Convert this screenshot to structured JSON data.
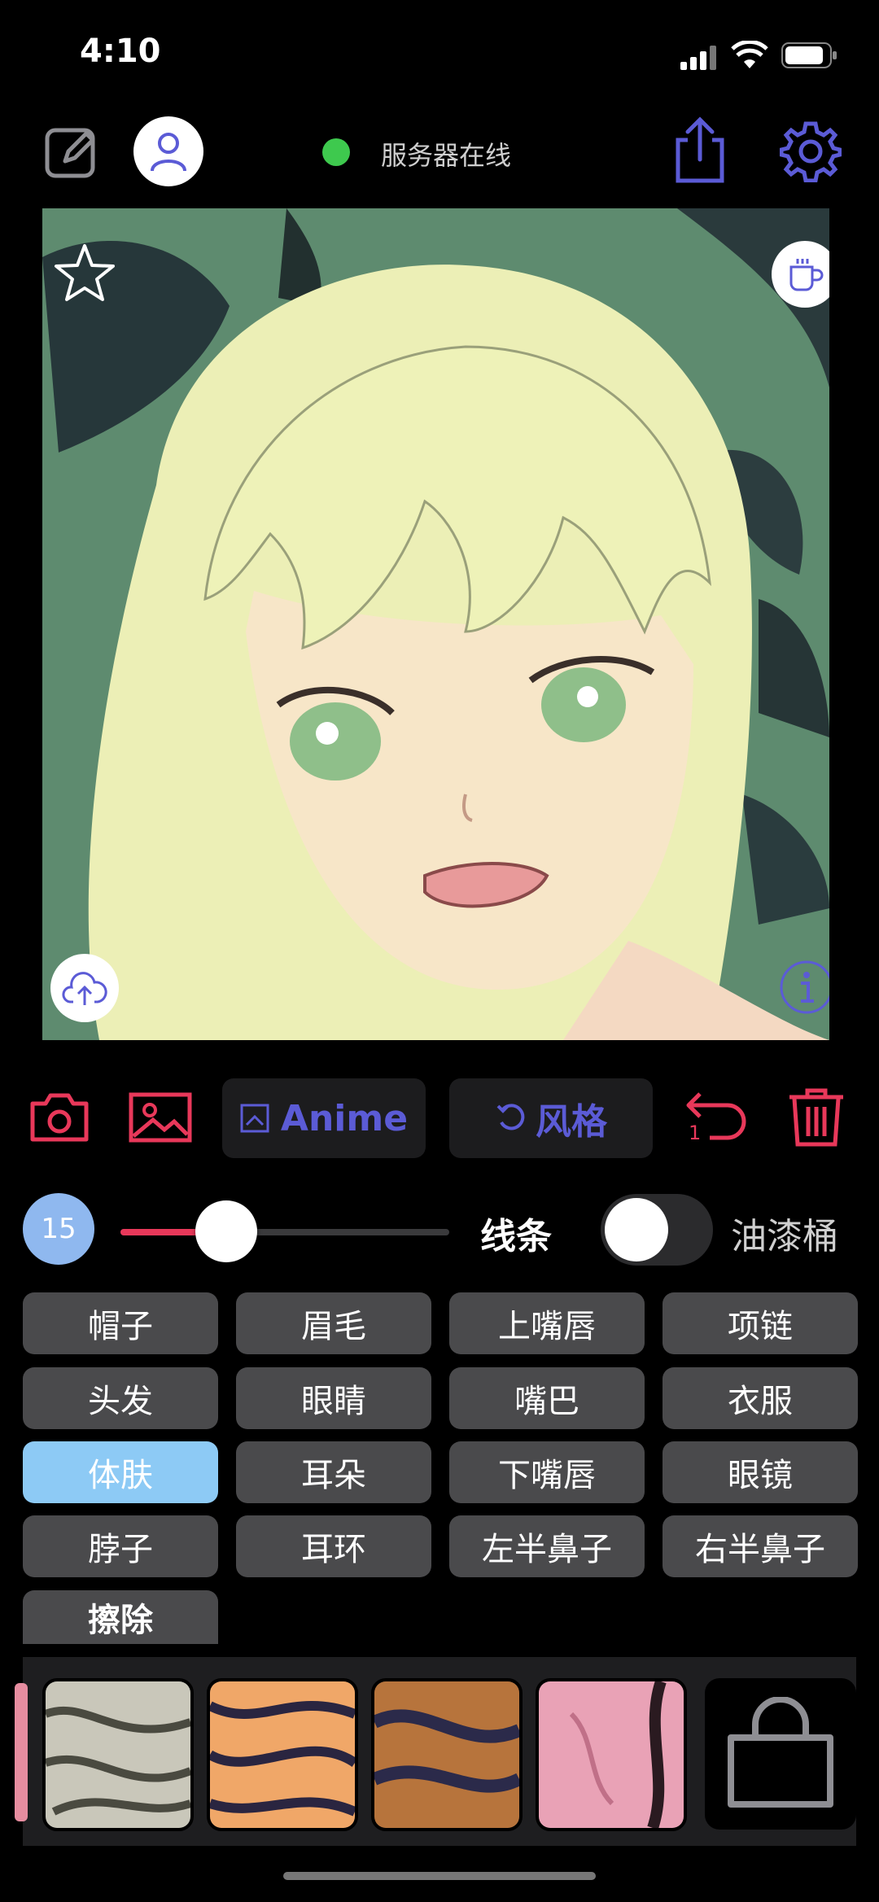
{
  "status_bar": {
    "time": "4:10"
  },
  "header": {
    "server_status": "服务器在线"
  },
  "toolbar": {
    "style_pill": "Anime",
    "style_button": "风格",
    "undo_count": "1"
  },
  "controls": {
    "brush_size": "15",
    "line_label": "线条",
    "bucket_label": "油漆桶",
    "slider_level_percent": 25,
    "toggle_on": false
  },
  "tags": [
    {
      "label": "帽子",
      "selected": false
    },
    {
      "label": "眉毛",
      "selected": false
    },
    {
      "label": "上嘴唇",
      "selected": false
    },
    {
      "label": "项链",
      "selected": false
    },
    {
      "label": "头发",
      "selected": false
    },
    {
      "label": "眼睛",
      "selected": false
    },
    {
      "label": "嘴巴",
      "selected": false
    },
    {
      "label": "衣服",
      "selected": false
    },
    {
      "label": "体肤",
      "selected": true
    },
    {
      "label": "耳朵",
      "selected": false
    },
    {
      "label": "下嘴唇",
      "selected": false
    },
    {
      "label": "眼镜",
      "selected": false
    },
    {
      "label": "脖子",
      "selected": false
    },
    {
      "label": "耳环",
      "selected": false
    },
    {
      "label": "左半鼻子",
      "selected": false
    },
    {
      "label": "右半鼻子",
      "selected": false
    },
    {
      "label": "擦除",
      "selected": false
    }
  ],
  "colors": {
    "accent_red": "#e8385a",
    "accent_purple": "#5b5bd6",
    "online": "#3ec94e",
    "selected_tag": "#8dcaf5"
  },
  "icons": [
    "edit-icon",
    "avatar-icon",
    "share-icon",
    "gear-icon",
    "star-icon",
    "coffee-icon",
    "upload-icon",
    "info-icon",
    "camera-icon",
    "image-icon",
    "undo-icon",
    "trash-icon",
    "bag-icon"
  ]
}
